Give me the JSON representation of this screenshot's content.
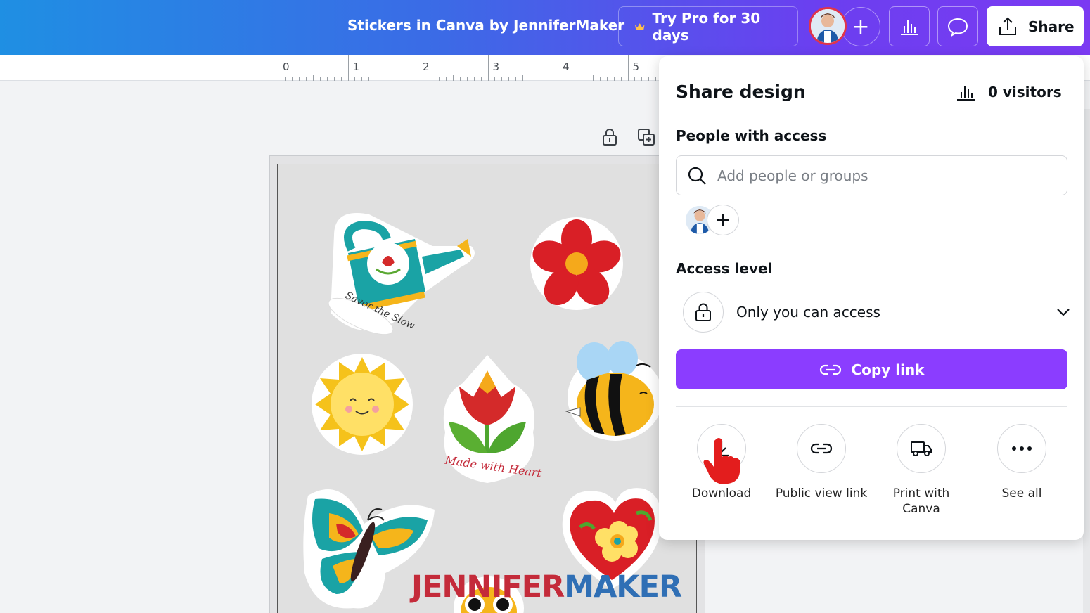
{
  "header": {
    "doc_title": "Stickers in Canva by JenniferMaker",
    "try_pro_label": "Try Pro for 30 days",
    "share_label": "Share",
    "icons": [
      "crown-icon",
      "avatar",
      "plus-icon",
      "insights-icon",
      "comment-icon",
      "share-upload-icon"
    ]
  },
  "ruler": {
    "marks": [
      "0",
      "1",
      "2",
      "3",
      "4",
      "5"
    ]
  },
  "canvas": {
    "sticker_texts": {
      "watering_can": "Savor the Slow",
      "tulip": "Made with Heart"
    },
    "watermark": {
      "part1": "JENNIFER",
      "part2": "MAKER"
    }
  },
  "share_panel": {
    "title": "Share design",
    "visitors_label": "0 visitors",
    "people_label": "People with access",
    "search_placeholder": "Add people or groups",
    "access_level_label": "Access level",
    "access_value": "Only you can access",
    "copy_link_label": "Copy link",
    "actions": [
      {
        "label": "Download",
        "icon": "download-icon"
      },
      {
        "label": "Public view link",
        "icon": "link-icon"
      },
      {
        "label": "Print with Canva",
        "icon": "truck-icon"
      },
      {
        "label": "See all",
        "icon": "more-icon"
      }
    ]
  },
  "colors": {
    "header_gradient_start": "#1f8fe3",
    "header_gradient_end": "#7b3af2",
    "copy_link_bg": "#8b3dff",
    "watermark_red": "#c42b3a",
    "watermark_blue": "#2f6fb5"
  }
}
